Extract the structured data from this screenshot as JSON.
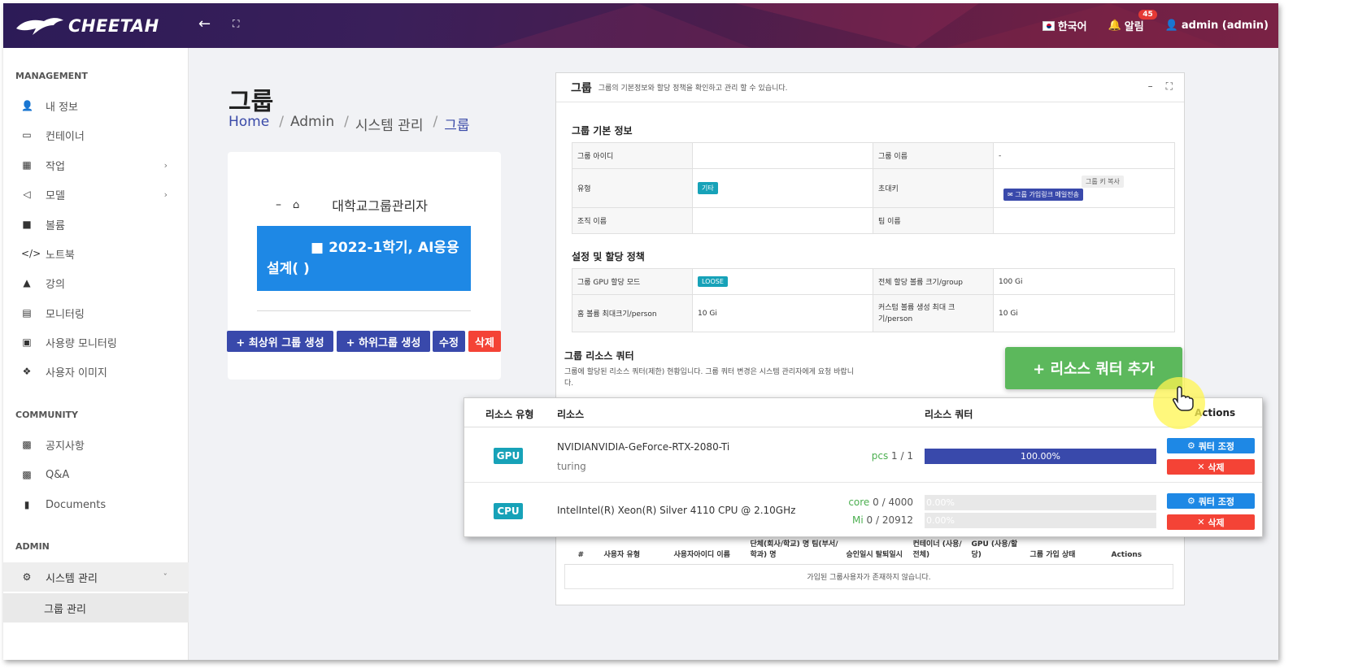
{
  "header": {
    "brand": "CHEETAH",
    "back_icon": "arrow-left-icon",
    "fullscreen_icon": "fullscreen-icon",
    "language": "한국어",
    "notifications_label": "알림",
    "notifications_count": "45",
    "user": "admin (admin)"
  },
  "sidebar": {
    "management_heading": "MANAGEMENT",
    "management_items": [
      {
        "label": "내 정보",
        "icon": "user-icon"
      },
      {
        "label": "컨테이너",
        "icon": "monitor-icon"
      },
      {
        "label": "작업",
        "icon": "calendar-icon"
      },
      {
        "label": "모델",
        "icon": "model-icon"
      },
      {
        "label": "볼륨",
        "icon": "folder-icon"
      },
      {
        "label": "노트북",
        "icon": "code-icon"
      },
      {
        "label": "강의",
        "icon": "graduation-icon"
      },
      {
        "label": "모니터링",
        "icon": "chart-icon"
      },
      {
        "label": "사용량 모니터링",
        "icon": "usage-icon"
      },
      {
        "label": "사용자 이미지",
        "icon": "cube-icon"
      }
    ],
    "community_heading": "COMMUNITY",
    "community_items": [
      {
        "label": "공지사항",
        "icon": "comments-icon"
      },
      {
        "label": "Q&A",
        "icon": "comments-icon"
      },
      {
        "label": "Documents",
        "icon": "book-icon"
      }
    ],
    "admin_heading": "ADMIN",
    "admin_item": "시스템 관리",
    "admin_sub_item": "그룹 관리"
  },
  "page": {
    "title": "그룹",
    "breadcrumb": [
      "Home",
      "Admin",
      "시스템 관리",
      "그룹"
    ]
  },
  "tree": {
    "root_label": "대학교그룹관리자",
    "node_label_line1": "2022-1학기, AI응용",
    "node_label_line2": "설계(         )",
    "buttons": {
      "create_top": "+ 최상위 그룹 생성",
      "create_sub": "+ 하위그룹 생성",
      "edit": "수정",
      "delete": "삭제"
    }
  },
  "panel": {
    "title": "그룹",
    "subtitle": "그룹의 기본정보와 할당 정책을 확인하고 관리 할 수 있습니다.",
    "basic_info": {
      "heading": "그룹 기본 정보",
      "group_id_label": "그룹 아이디",
      "group_id_value": "",
      "group_name_label": "그룹 이름",
      "group_name_value": "-",
      "type_label": "유형",
      "type_value": "기타",
      "invite_label": "초대키",
      "copy_key_button": "그룹 키 복사",
      "mail_button": "그룹 가입링크 메일전송",
      "org_label": "조직 이름",
      "org_value": "",
      "team_label": "팀 이름",
      "team_value": ""
    },
    "policy": {
      "heading": "설정 및 할당 정책",
      "gpu_mode_label": "그룹 GPU 할당 모드",
      "gpu_mode_value": "LOOSE",
      "total_volume_label": "전체 할당 볼륨 크기/group",
      "total_volume_value": "100 Gi",
      "home_volume_label": "홈 볼륨 최대크기/person",
      "home_volume_value": "10 Gi",
      "custom_volume_label": "커스텀 볼륨 생성 최대 크기/person",
      "custom_volume_value": "10 Gi"
    },
    "quota": {
      "heading": "그룹 리소스 쿼터",
      "description": "그룹에 할당된 리소스 쿼터(제한) 현황입니다. 그룹 쿼터 변경은 시스템 관리자에게 요청 바랍니다.",
      "add_button": "+ 리소스 쿼터 추가",
      "columns": [
        "리소스 유형",
        "리소스",
        "리소스 쿼터",
        "Actions"
      ],
      "rows": [
        {
          "type": "GPU",
          "name": "NVIDIANVIDIA-GeForce-RTX-2080-Ti",
          "sub": "turing",
          "quotas": [
            {
              "unit": "pcs",
              "used": "1",
              "total": "1",
              "percent_label": "100.00%",
              "fraction": 1.0
            }
          ]
        },
        {
          "type": "CPU",
          "name": "IntelIntel(R) Xeon(R) Silver 4110 CPU @ 2.10GHz",
          "sub": "",
          "quotas": [
            {
              "unit": "core",
              "used": "0",
              "total": "4000",
              "percent_label": "0.00%",
              "fraction": 0.0
            },
            {
              "unit": "Mi",
              "used": "0",
              "total": "20912",
              "percent_label": "0.00%",
              "fraction": 0.0
            }
          ]
        }
      ],
      "adjust_button": "쿼터 조정",
      "delete_button": "삭제"
    },
    "members": {
      "columns": [
        "#",
        "사용자 유형",
        "사용자아이디 이름",
        "단체(회사/학교) 명 팀(부서/학과) 명",
        "승인일시 탈퇴일시",
        "컨테이너 (사용/전체)",
        "GPU (사용/할당)",
        "그룹 가입 상태",
        "Actions"
      ],
      "empty_message": "가입된 그룹사용자가 존재하지 않습니다."
    }
  },
  "colors": {
    "primary": "#3949ab",
    "accent_blue": "#1e88e5",
    "danger": "#f44336",
    "success": "#5cb85c",
    "teal": "#17a2b8"
  }
}
